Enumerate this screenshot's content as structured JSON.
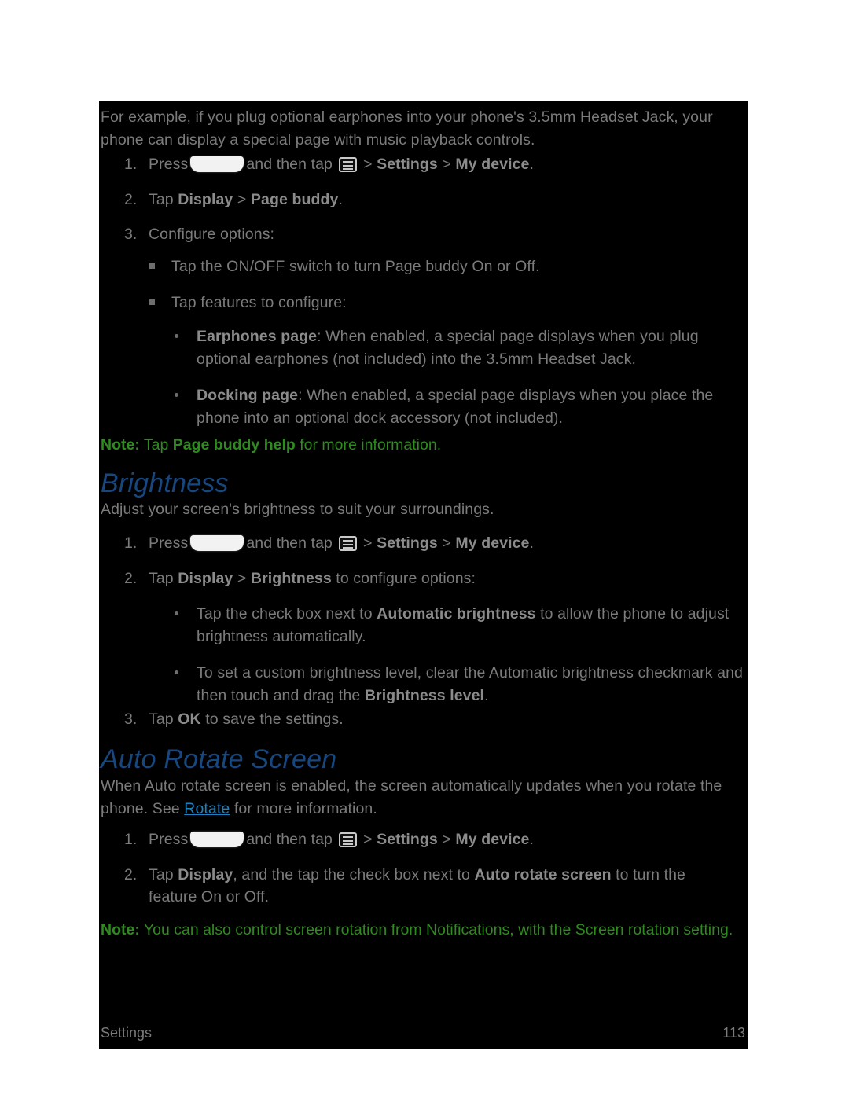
{
  "document": {
    "footer": {
      "section": "Settings",
      "page_number": "113"
    }
  },
  "icons": {
    "home_key": "home-key-icon",
    "menu_key": "menu-key-icon"
  },
  "colors": {
    "page_background": "#ffffff",
    "content_background": "#000000",
    "body_text": "#7b7b7b",
    "bold_text": "#8b8b8b",
    "heading": "#17477f",
    "note": "#2f8a1f",
    "link": "#1f82bf"
  },
  "content": {
    "intro": {
      "line1": "For example, if you plug optional earphones into your phone's 3.5mm Headset Jack, your",
      "line2": "phone can display a special page with music playback controls."
    },
    "pagebuddy_steps": [
      {
        "num": "1.",
        "pre": "Press",
        "mid": "and then tap",
        "chevron1": ">",
        "bold1": "Settings",
        "chevron2": ">",
        "bold2": "My device",
        "post": "."
      },
      {
        "num": "2.",
        "pre": "Tap",
        "bold1": "Display",
        "chevron1": ">",
        "bold2": "Page buddy",
        "post": "."
      },
      {
        "num": "3.",
        "pre": "Configure options:"
      }
    ],
    "pagebuddy_square_bullets": [
      "Tap the ON/OFF switch to turn Page buddy On or Off.",
      "Tap features to configure:"
    ],
    "pagebuddy_dot_bullets": [
      {
        "bold": "Earphones page",
        "text": ": When enabled, a special page displays when you plug optional earphones (not included) into the 3.5mm Headset Jack."
      },
      {
        "bold": "Docking page",
        "text": ": When enabled, a special page displays when you place the phone into an optional dock accessory (not included)."
      }
    ],
    "note_pagebuddy": {
      "label": "Note:",
      "pre": " Tap ",
      "bold": "Page buddy help",
      "post": " for more information."
    },
    "brightness": {
      "heading": "Brightness",
      "intro": "Adjust your screen's brightness to suit your surroundings.",
      "steps": [
        {
          "num": "1.",
          "pre": "Press",
          "mid": "and then tap",
          "chevron1": ">",
          "bold1": "Settings",
          "chevron2": ">",
          "bold2": "My device",
          "post": "."
        },
        {
          "num": "2.",
          "pre": "Tap",
          "bold1": "Display",
          "chevron1": ">",
          "bold2": "Brightness",
          "post": " to configure options:"
        },
        {
          "num": "3.",
          "pre": "Tap",
          "bold1": "OK",
          "post": " to save the settings."
        }
      ],
      "dot_bullets": [
        {
          "pre": "Tap the check box next to ",
          "bold": "Automatic brightness",
          "post": " to allow the phone to adjust brightness automatically."
        },
        {
          "pre": "To set a custom brightness level, clear the Automatic brightness checkmark and then touch and drag the ",
          "bold": "Brightness level",
          "post": "."
        }
      ]
    },
    "auto_rotate": {
      "heading": "Auto Rotate Screen",
      "intro_pre": "When Auto rotate screen is enabled, the screen automatically updates when you rotate the phone. See ",
      "intro_link": "Rotate",
      "intro_post": " for more information.",
      "steps": [
        {
          "num": "1.",
          "pre": "Press",
          "mid": "and then tap",
          "chevron1": ">",
          "bold1": "Settings",
          "chevron2": ">",
          "bold2": "My device",
          "post": "."
        },
        {
          "num": "2.",
          "pre": "Tap ",
          "bold1": "Display",
          "mid": ", and the tap the check box next to ",
          "bold2": "Auto rotate screen",
          "post": " to turn the feature On or Off."
        }
      ],
      "note": {
        "label": "Note:",
        "text": " You can also control screen rotation from Notifications, with the Screen rotation setting."
      }
    }
  }
}
